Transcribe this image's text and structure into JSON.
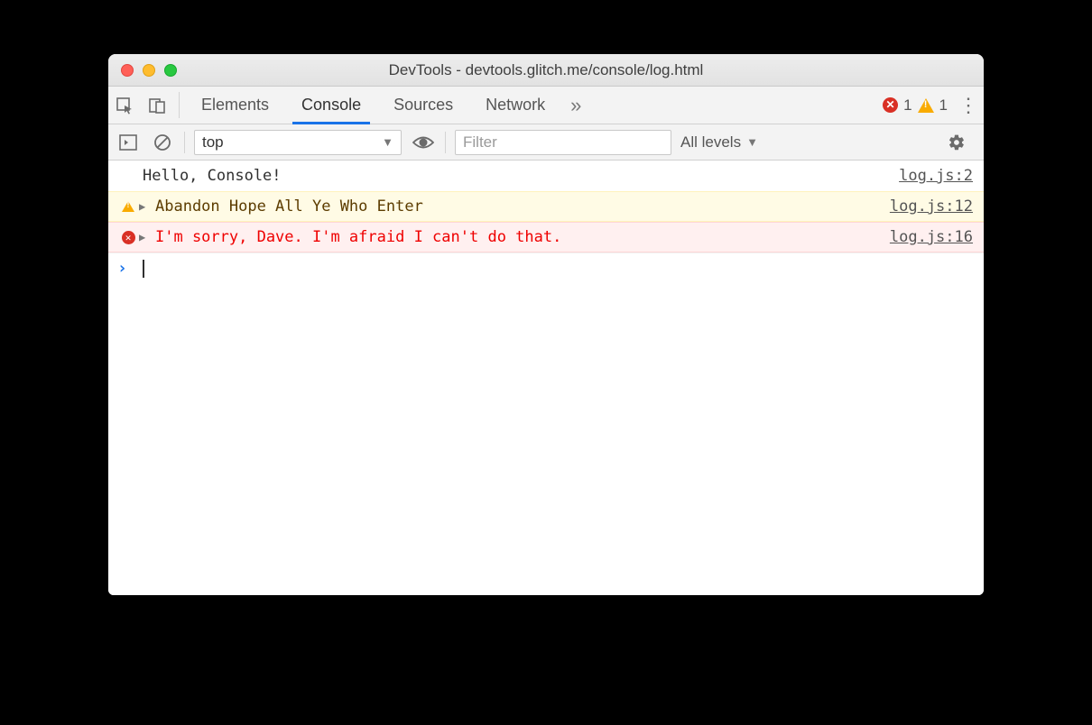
{
  "window": {
    "title": "DevTools - devtools.glitch.me/console/log.html"
  },
  "tabs": {
    "items": [
      "Elements",
      "Console",
      "Sources",
      "Network"
    ],
    "activeIndex": 1,
    "overflow_glyph": "»"
  },
  "badges": {
    "error_count": "1",
    "warning_count": "1"
  },
  "filterbar": {
    "context": "top",
    "filter_placeholder": "Filter",
    "levels_label": "All levels"
  },
  "messages": [
    {
      "type": "log",
      "text": "Hello, Console!",
      "source": "log.js:2",
      "expandable": false
    },
    {
      "type": "warn",
      "text": "Abandon Hope All Ye Who Enter",
      "source": "log.js:12",
      "expandable": true
    },
    {
      "type": "error",
      "text": "I'm sorry, Dave. I'm afraid I can't do that.",
      "source": "log.js:16",
      "expandable": true
    }
  ],
  "prompt": {
    "caret": "›"
  }
}
